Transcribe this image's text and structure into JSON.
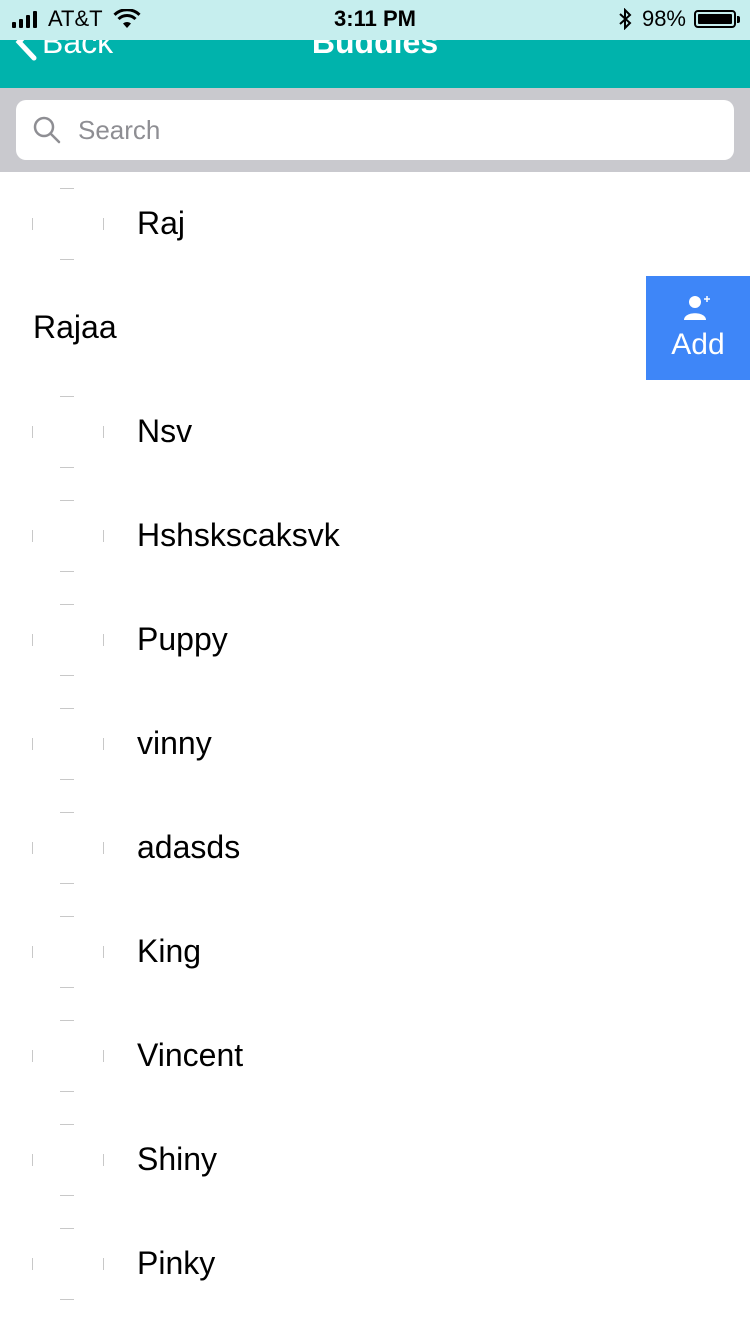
{
  "status_bar": {
    "carrier": "AT&T",
    "time": "3:11 PM",
    "battery_percent": "98%",
    "icons": [
      "signal-icon",
      "wifi-icon",
      "bluetooth-icon",
      "battery-icon"
    ]
  },
  "nav": {
    "back_label": "Back",
    "title": "Buddies"
  },
  "search": {
    "placeholder": "Search",
    "value": ""
  },
  "buddies": [
    {
      "name": "Raj"
    },
    {
      "name": "Rajaa",
      "swiped": true,
      "action_label": "Add"
    },
    {
      "name": "Nsv"
    },
    {
      "name": "Hshskscaksvk"
    },
    {
      "name": "Puppy"
    },
    {
      "name": "vinny"
    },
    {
      "name": "adasds"
    },
    {
      "name": "King"
    },
    {
      "name": "Vincent"
    },
    {
      "name": "Shiny"
    },
    {
      "name": "Pinky"
    }
  ],
  "colors": {
    "nav_bg": "#00b3ac",
    "status_bg": "#c6eeee",
    "add_action": "#3e86f8",
    "search_bg": "#c9c9ce"
  }
}
